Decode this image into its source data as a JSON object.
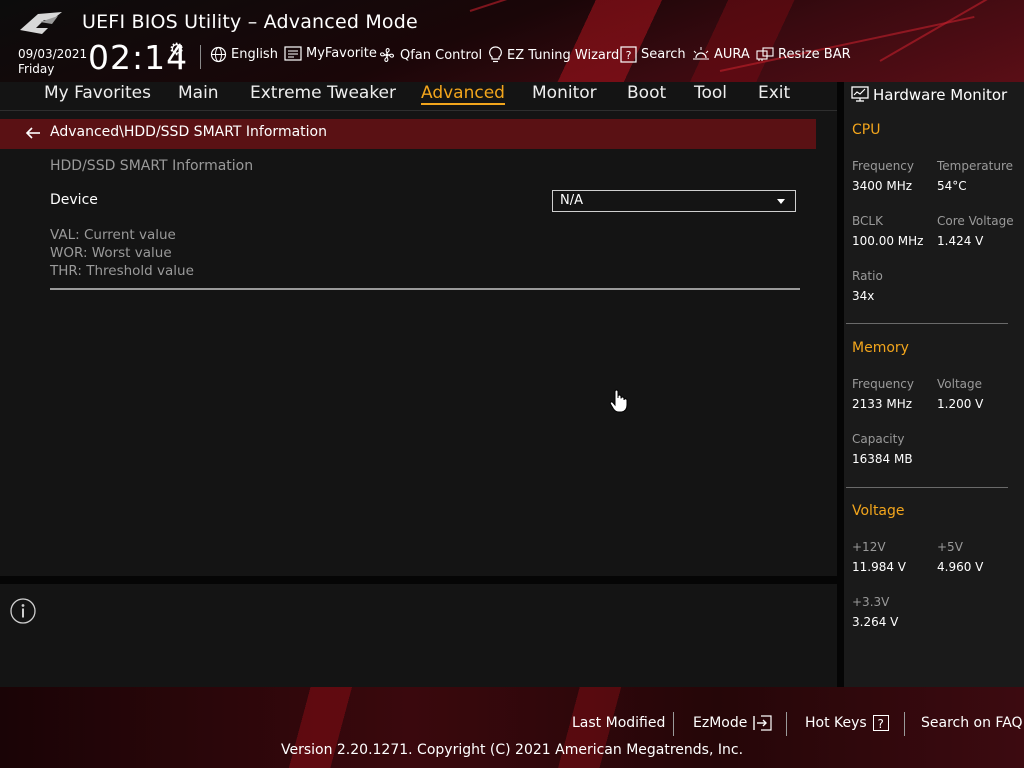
{
  "header": {
    "title": "UEFI BIOS Utility – Advanced Mode",
    "date": "09/03/2021",
    "day": "Friday",
    "time": "02:14",
    "tools": [
      {
        "label": "English",
        "icon": "globe-icon"
      },
      {
        "label": "MyFavorite",
        "icon": "favorite-list-icon"
      },
      {
        "label": "Qfan Control",
        "icon": "fan-icon"
      },
      {
        "label": "EZ Tuning Wizard",
        "icon": "lightbulb-icon"
      },
      {
        "label": "Search",
        "icon": "question-box-icon"
      },
      {
        "label": "AURA",
        "icon": "aura-light-icon"
      },
      {
        "label": "Resize BAR",
        "icon": "resize-bar-icon"
      }
    ]
  },
  "nav": {
    "tabs": [
      "My Favorites",
      "Main",
      "Extreme Tweaker",
      "Advanced",
      "Monitor",
      "Boot",
      "Tool",
      "Exit"
    ],
    "active": "Advanced"
  },
  "breadcrumb": "Advanced\\HDD/SSD SMART Information",
  "content": {
    "section_title": "HDD/SSD SMART Information",
    "device_label": "Device",
    "device_value": "N/A",
    "legend": [
      "VAL: Current value",
      "WOR: Worst value",
      "THR: Threshold value"
    ]
  },
  "hardware_monitor": {
    "title": "Hardware Monitor",
    "cpu": {
      "heading": "CPU",
      "frequency_label": "Frequency",
      "frequency": "3400 MHz",
      "temperature_label": "Temperature",
      "temperature": "54°C",
      "bclk_label": "BCLK",
      "bclk": "100.00 MHz",
      "core_voltage_label": "Core Voltage",
      "core_voltage": "1.424 V",
      "ratio_label": "Ratio",
      "ratio": "34x"
    },
    "memory": {
      "heading": "Memory",
      "frequency_label": "Frequency",
      "frequency": "2133 MHz",
      "voltage_label": "Voltage",
      "voltage": "1.200 V",
      "capacity_label": "Capacity",
      "capacity": "16384 MB"
    },
    "voltage": {
      "heading": "Voltage",
      "v12_label": "+12V",
      "v12": "11.984 V",
      "v5_label": "+5V",
      "v5": "4.960 V",
      "v33_label": "+3.3V",
      "v33": "3.264 V"
    }
  },
  "footer": {
    "last_modified": "Last Modified",
    "ezmode": "EzMode",
    "hot_keys": "Hot Keys",
    "hot_keys_box": "?",
    "search_faq": "Search on FAQ",
    "copyright": "Version 2.20.1271. Copyright (C) 2021 American Megatrends, Inc."
  },
  "colors": {
    "accent": "#f2a51c",
    "breadcrumb_bg": "#5a1114",
    "background": "#141414"
  }
}
